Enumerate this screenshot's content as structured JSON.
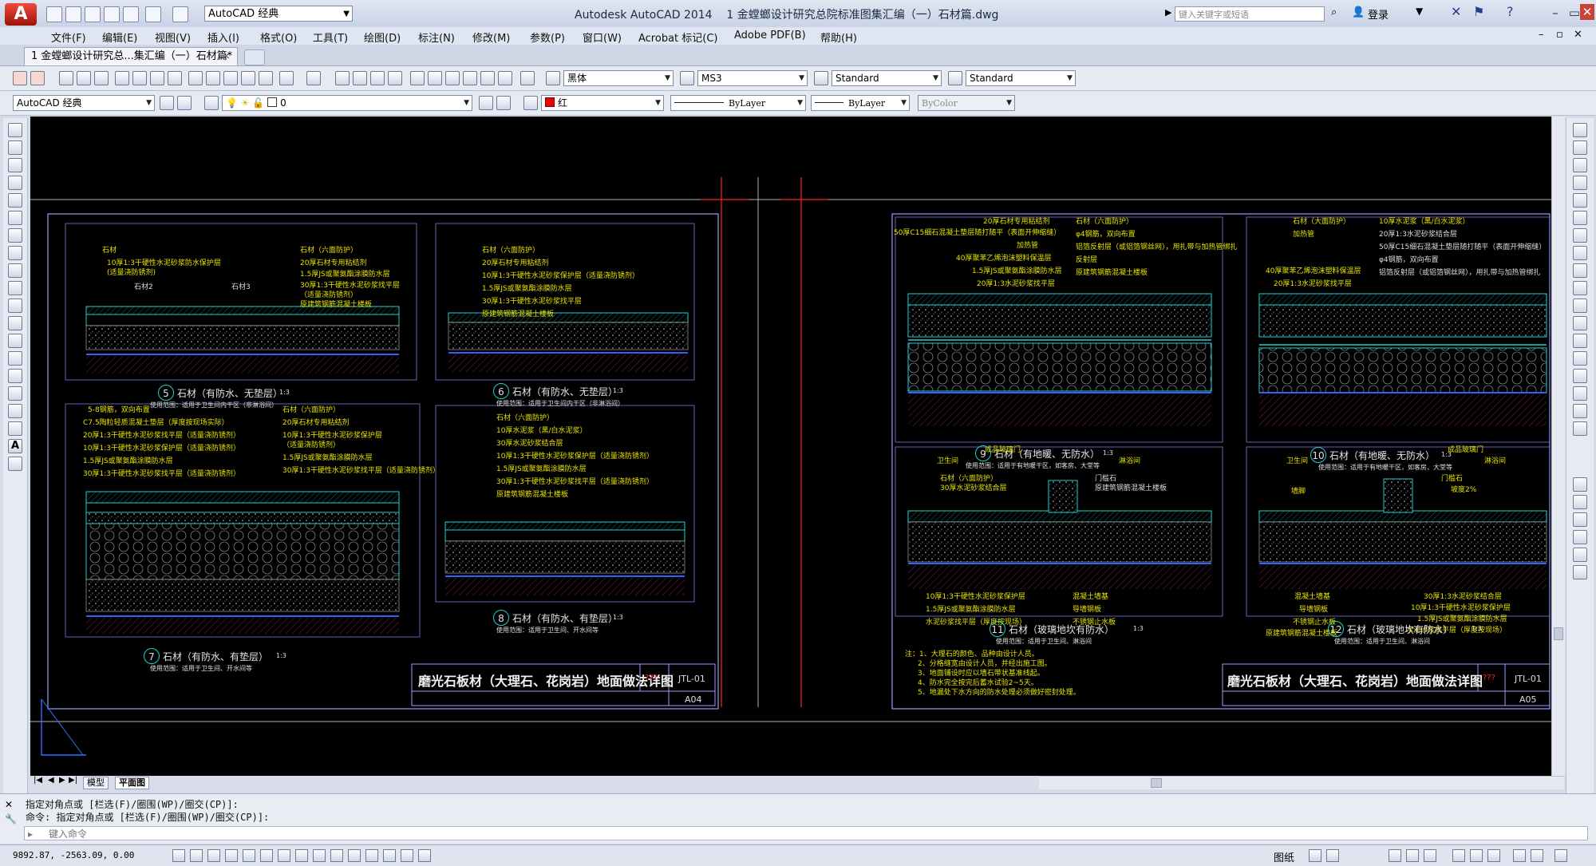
{
  "title_bar": {
    "app_title": "Autodesk AutoCAD 2014",
    "file_title": "1 金螳螂设计研究总院标准图集汇编（一）石材篇.dwg",
    "workspace": "AutoCAD 经典",
    "search_placeholder": "键入关键字或短语",
    "login": "登录"
  },
  "menu": [
    "文件(F)",
    "编辑(E)",
    "视图(V)",
    "插入(I)",
    "格式(O)",
    "工具(T)",
    "绘图(D)",
    "标注(N)",
    "修改(M)",
    "参数(P)",
    "窗口(W)",
    "Acrobat 标记(C)",
    "Adobe PDF(B)",
    "帮助(H)"
  ],
  "doc_tab": {
    "label": "1 金螳螂设计研究总...集汇编（一）石材篇*",
    "close": "×"
  },
  "toolbar1": {
    "text_font": "黑体",
    "dim_style": "MS3",
    "table_style": "Standard",
    "multileader_style": "Standard"
  },
  "toolbar2": {
    "workspace": "AutoCAD 经典",
    "layer": "0",
    "color": "红",
    "linetype": "ByLayer",
    "lineweight": "ByLayer",
    "plotstyle": "ByColor"
  },
  "layout_tabs": [
    "模型",
    "平面图"
  ],
  "command": {
    "line1": "指定对角点或 [栏选(F)/圈围(WP)/圈交(CP)]:",
    "line2": "命令: 指定对角点或 [栏选(F)/圈围(WP)/圈交(CP)]:",
    "placeholder": "键入命令"
  },
  "status": {
    "coords": "9892.87, -2563.09, 0.00",
    "space": "图纸"
  },
  "sheets": [
    {
      "title": "磨光石板材（大理石、花岗岩）地面做法详图",
      "code": "JTL-01",
      "sheet_no": "A04",
      "qmarks": "???",
      "details": [
        {
          "num": "5",
          "name": "石材（有防水、无垫层）",
          "scale": "1:3",
          "usage": "使用范围：适用于卫生间内干区（非淋浴间）",
          "labels": [
            "石材",
            "10厚1:3干硬性水泥砂浆防水保护层",
            "(适量浇防锈剂)",
            "石材2",
            "石材3"
          ],
          "labels2": [
            "石材（六面防护）",
            "20厚石材专用粘结剂",
            "1.5厚JS或聚氨酯涂膜防水层",
            "30厚1:3干硬性水泥砂浆找平层",
            "（适量浇防锈剂）",
            "原建筑钢筋混凝土楼板"
          ]
        },
        {
          "num": "6",
          "name": "石材（有防水、无垫层）",
          "scale": "1:3",
          "usage": "使用范围：适用于卫生间内干区（非淋浴间）",
          "labels": [
            "石材（六面防护）",
            "20厚石材专用粘结剂",
            "10厚1:3干硬性水泥砂浆保护层（适量浇防锈剂）",
            "1.5厚JS或聚氨酯涂膜防水层",
            "30厚1:3干硬性水泥砂浆找平层",
            "原建筑钢筋混凝土楼板"
          ]
        },
        {
          "num": "7",
          "name": "石材（有防水、有垫层）",
          "scale": "1:3",
          "usage": "使用范围：适用于卫生间、开水间等",
          "labels": [
            "5-8钢筋，双向布置",
            "C7.5陶粒轻质混凝土垫层（厚度按现场实际）",
            "20厚1:3干硬性水泥砂浆找平层（适量浇防锈剂）",
            "10厚1:3干硬性水泥砂浆保护层（适量浇防锈剂）",
            "1.5厚JS或聚氨酯涂膜防水层",
            "30厚1:3干硬性水泥砂浆找平层（适量浇防锈剂）"
          ],
          "labels2": [
            "石材（六面防护）",
            "20厚石材专用粘结剂",
            "10厚1:3干硬性水泥砂浆保护层",
            "（适量浇防锈剂）",
            "1.5厚JS或聚氨酯涂膜防水层",
            "30厚1:3干硬性水泥砂浆找平层（适量浇防锈剂）"
          ]
        },
        {
          "num": "8",
          "name": "石材（有防水、有垫层）",
          "scale": "1:3",
          "usage": "使用范围：适用于卫生间、开水间等",
          "labels": [
            "石材（六面防护）",
            "10厚水泥浆（黑/白水泥浆）",
            "30厚水泥砂浆结合层",
            "10厚1:3干硬性水泥砂浆保护层（适量浇防锈剂）",
            "1.5厚JS或聚氨酯涂膜防水层",
            "30厚1:3干硬性水泥砂浆找平层（适量浇防锈剂）",
            "原建筑钢筋混凝土楼板"
          ]
        }
      ]
    },
    {
      "title": "磨光石板材（大理石、花岗岩）地面做法详图",
      "code": "JTL-01",
      "sheet_no": "A05",
      "qmarks": "???",
      "details": [
        {
          "num": "9",
          "name": "石材（有地暖、无防水）",
          "scale": "1:3",
          "usage": "使用范围：适用于有地暖干区，如客房、大堂等",
          "labels": [
            "20厚石材专用粘结剂",
            "50厚C15细石混凝土垫层随打随平（表面开伸缩缝）",
            "加热管",
            "40厚聚苯乙烯泡沫塑料保温层",
            "1.5厚JS或聚氨酯涂膜防水层",
            "20厚1:3水泥砂浆找平层"
          ],
          "labels2": [
            "石材（六面防护）",
            "φ4钢筋，双向布置",
            "铝箔反射层（或铝箔钢丝网），用扎带与加热管绑扎",
            "反射层",
            "原建筑钢筋混凝土楼板"
          ]
        },
        {
          "num": "10",
          "name": "石材（有地暖、无防水）",
          "scale": "1:3",
          "usage": "使用范围：适用于有地暖干区，如客房、大堂等",
          "labels": [
            "石材（大面防护）",
            "加热管",
            "40厚聚苯乙烯泡沫塑料保温层",
            "20厚1:3水泥砂浆找平层"
          ],
          "labels2": [
            "10厚水泥浆（黑/白水泥浆）",
            "20厚1:3水泥砂浆结合层",
            "50厚C15细石混凝土垫层随打随平（表面开伸缩缝）",
            "φ4钢筋，双向布置",
            "铝箔反射层（或铝箔钢丝网），用扎带与加热管绑扎"
          ]
        },
        {
          "num": "11",
          "name": "石材（玻璃地坎有防水）",
          "scale": "1:3",
          "usage": "使用范围：适用于卫生间、淋浴间",
          "labels": [
            "卫生间",
            "成品玻璃门",
            "淋浴间",
            "石材（六面防护）",
            "30厚水泥砂浆结合层",
            "门槛石",
            "原建筑钢筋混凝土楼板",
            "10厚1:3干硬性水泥砂浆保护层",
            "1.5厚JS或聚氨酯涂膜防水层",
            "水泥砂浆找平层（厚度按现场）",
            "混凝土墙基",
            "导墙钢板",
            "不锈钢止水板"
          ]
        },
        {
          "num": "12",
          "name": "石材（玻璃地坎有防水）",
          "scale": "1:3",
          "usage": "使用范围：适用于卫生间、淋浴间",
          "labels": [
            "卫生间",
            "成品玻璃门",
            "淋浴间",
            "门槛石",
            "坡度2%",
            "墙脚",
            "混凝土墙基",
            "导墙钢板",
            "不锈钢止水板",
            "原建筑钢筋混凝土楼板",
            "30厚1:3水泥砂浆结合层",
            "10厚1:3干硬性水泥砂浆保护层",
            "1.5厚JS或聚氨酯涂膜防水层",
            "水泥砂浆找平层（厚度按现场）"
          ]
        }
      ],
      "notes": [
        "注：1、大理石的颜色、品种由设计人员。",
        "2、分格缝宽由设计人员，并经出施工图。",
        "3、地面铺设时应以墙石带状基准线起。",
        "4、防水完全按完后蓄水试验2~5天。",
        "5、地漏处下水方向的防水处理必须做好密封处理。"
      ]
    }
  ]
}
